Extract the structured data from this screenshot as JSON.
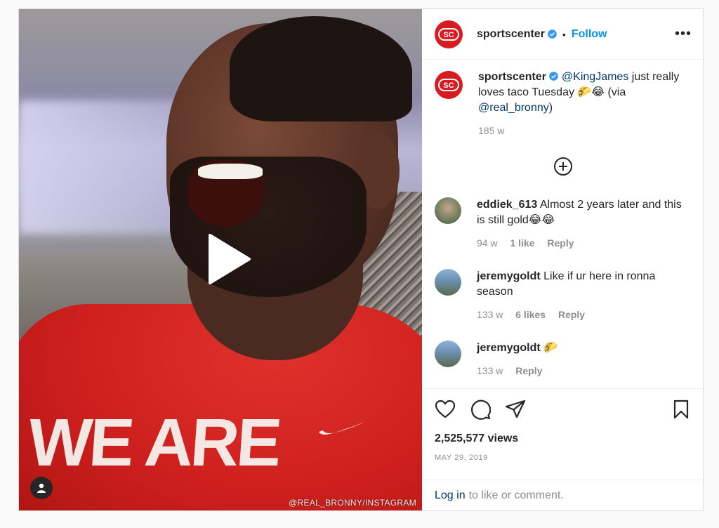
{
  "header": {
    "username": "sportscenter",
    "separator": "•",
    "follow_label": "Follow",
    "more_label": "•••",
    "logo_text": "SC"
  },
  "video": {
    "shirt_text": "WE ARE",
    "watermark": "@REAL_BRONNY/INSTAGRAM"
  },
  "caption": {
    "username": "sportscenter",
    "mention": "@KingJames",
    "text": " just really loves taco Tuesday 🌮😂 (via ",
    "via_mention": "@real_bronny",
    "close": ")",
    "time": "185 w"
  },
  "comments": [
    {
      "username": "eddiek_613",
      "text": "Almost 2 years later and this is still gold😂😂",
      "time": "94 w",
      "likes": "1 like",
      "reply": "Reply"
    },
    {
      "username": "jeremygoldt",
      "text": "Like if ur here in ronna season",
      "time": "133 w",
      "likes": "6 likes",
      "reply": "Reply"
    },
    {
      "username": "jeremygoldt",
      "text": "🌮",
      "time": "133 w",
      "reply": "Reply"
    }
  ],
  "stats": {
    "views": "2,525,577 views",
    "date": "MAY 29, 2019"
  },
  "login": {
    "link": "Log in",
    "text": "to like or comment."
  },
  "colors": {
    "brand_red": "#d81b21",
    "follow_blue": "#0095f6",
    "link_navy": "#00376b",
    "muted": "#8e8e8e"
  },
  "icons": [
    "verified-badge-icon",
    "more-options-icon",
    "load-more-comments-icon",
    "heart-icon",
    "comment-icon",
    "share-icon",
    "bookmark-icon",
    "play-icon",
    "tagged-user-icon"
  ]
}
